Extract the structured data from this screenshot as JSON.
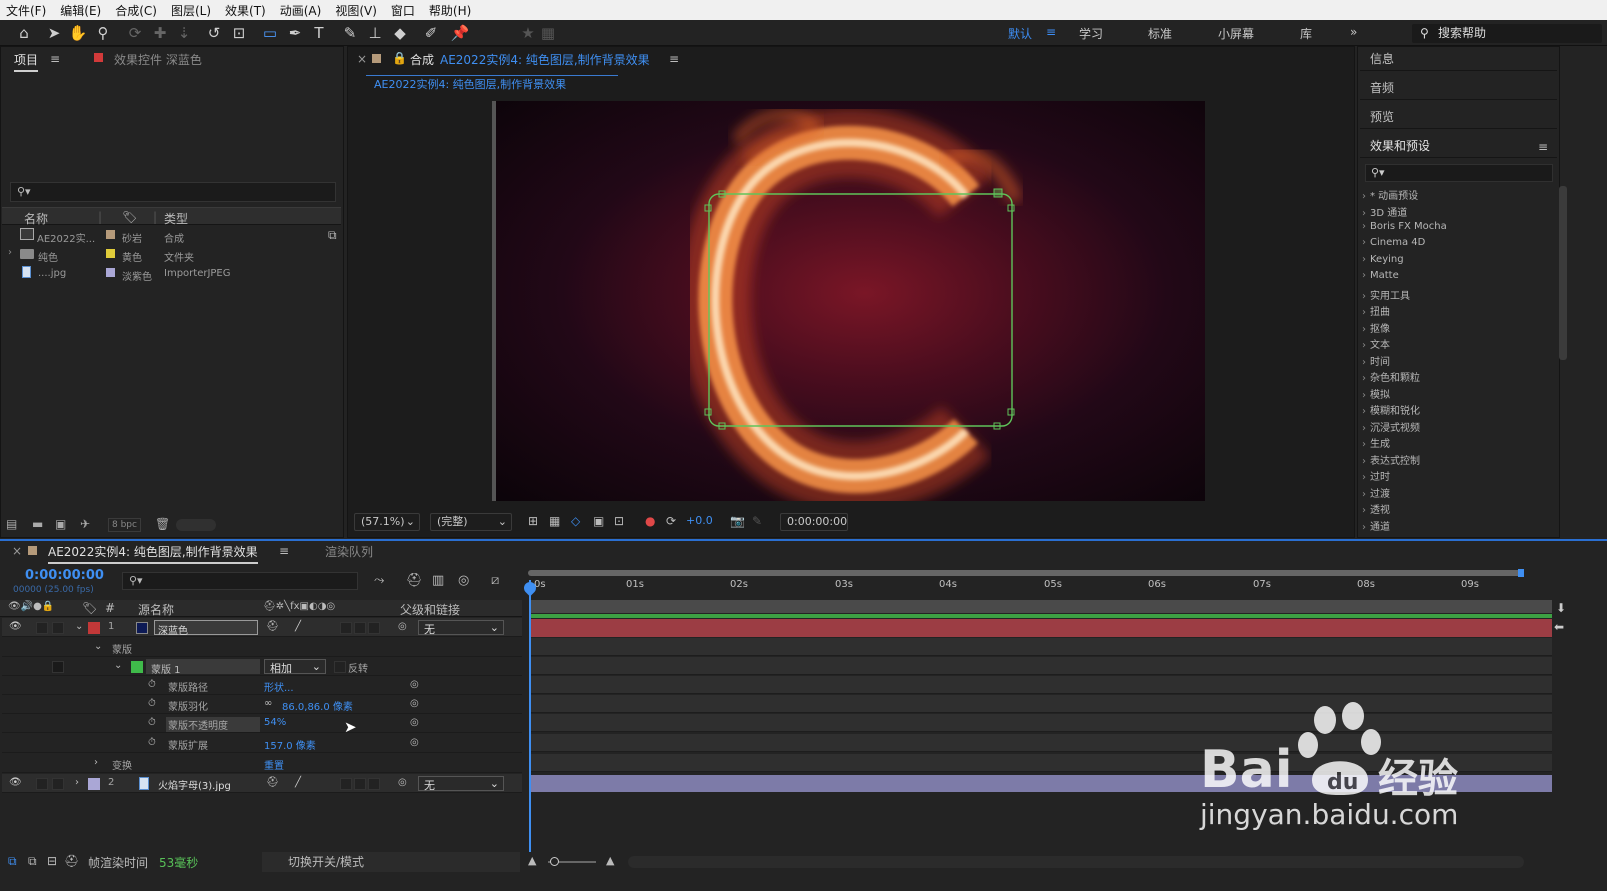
{
  "menu": [
    "文件(F)",
    "编辑(E)",
    "合成(C)",
    "图层(L)",
    "效果(T)",
    "动画(A)",
    "视图(V)",
    "窗口",
    "帮助(H)"
  ],
  "workspaces": {
    "default": "默认",
    "learn": "学习",
    "standard": "标准",
    "small": "小屏幕",
    "library": "库"
  },
  "help_search": "搜索帮助",
  "project": {
    "tab": "项目",
    "effects_tab": "效果控件 深蓝色",
    "col_name": "名称",
    "col_type": "类型",
    "items": [
      {
        "name": "AE2022实...",
        "label": "砂岩",
        "type": "合成",
        "color": "#b59a7a"
      },
      {
        "name": "纯色",
        "label": "黄色",
        "type": "文件夹",
        "color": "#e0cc3a"
      },
      {
        "name": "....jpg",
        "label": "淡紫色",
        "type": "ImporterJPEG",
        "color": "#aaa7d6"
      }
    ],
    "bpc": "8 bpc"
  },
  "comp": {
    "tab_prefix": "合成",
    "name": "AE2022实例4: 纯色图层,制作背景效果",
    "sub": "AE2022实例4: 纯色图层,制作背景效果",
    "zoom": "(57.1%)",
    "quality": "(完整)",
    "exposure": "+0.0",
    "timecode": "0:00:00:00"
  },
  "right": {
    "info": "信息",
    "audio": "音频",
    "preview": "预览",
    "effects": "效果和预设",
    "fx_list": [
      "* 动画预设",
      "3D 通道",
      "Boris FX Mocha",
      "Cinema 4D",
      "Keying",
      "Matte",
      "实用工具",
      "扭曲",
      "抠像",
      "文本",
      "时间",
      "杂色和颗粒",
      "模拟",
      "模糊和锐化",
      "沉浸式视频",
      "生成",
      "表达式控制",
      "过时",
      "过渡",
      "透视",
      "通道"
    ]
  },
  "timeline": {
    "tab": "AE2022实例4: 纯色图层,制作背景效果",
    "render_tab": "渲染队列",
    "timecode": "0:00:00:00",
    "fps": "00000 (25.00 fps)",
    "col_source": "源名称",
    "col_parent": "父级和链接",
    "ticks": [
      "0s",
      "01s",
      "02s",
      "03s",
      "04s",
      "05s",
      "06s",
      "07s",
      "08s",
      "09s"
    ],
    "layer1": {
      "num": "1",
      "name": "深蓝色",
      "parent": "无"
    },
    "masks_label": "蒙版",
    "mask1": "蒙版 1",
    "mask_mode": "相加",
    "invert": "反转",
    "props": [
      {
        "name": "蒙版路径",
        "value": "形状..."
      },
      {
        "name": "蒙版羽化",
        "value": "86.0,86.0 像素"
      },
      {
        "name": "蒙版不透明度",
        "value": "54%"
      },
      {
        "name": "蒙版扩展",
        "value": "157.0 像素"
      }
    ],
    "transform": "变换",
    "reset": "重置",
    "layer2": {
      "num": "2",
      "name": "火焰字母(3).jpg",
      "parent": "无"
    },
    "render_time_label": "帧渲染时间",
    "render_time": "53毫秒",
    "toggle": "切换开关/模式"
  },
  "watermark": {
    "brand": "Bai",
    "paw": "du",
    "jingyan": "经验",
    "url": "jingyan.baidu.com"
  }
}
